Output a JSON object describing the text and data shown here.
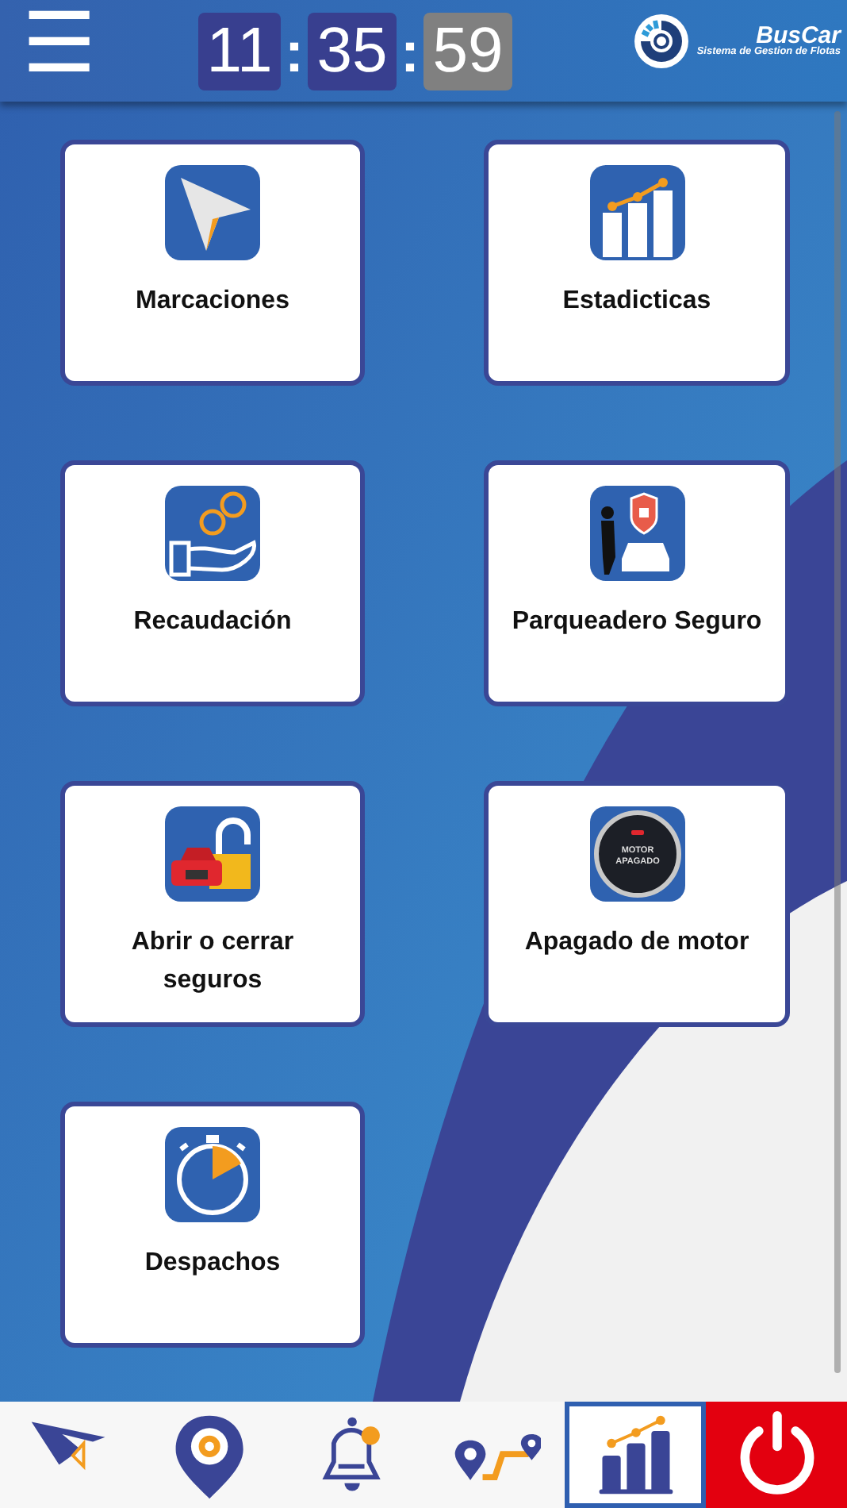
{
  "header": {
    "menu_label": "☰",
    "clock": [
      {
        "text": "11",
        "color": "#383f8f"
      },
      {
        "text": "35",
        "color": "#383f8f"
      },
      {
        "text": "59",
        "color": "#808080"
      }
    ],
    "separator": ":",
    "logo": {
      "title": "BusCar",
      "subtitle": "Sistema de Gestion de Flotas"
    }
  },
  "tiles": [
    {
      "label": "Marcaciones"
    },
    {
      "label": "Estadicticas"
    },
    {
      "label": "Recaudación"
    },
    {
      "label": "Parqueadero Seguro"
    },
    {
      "label": "Abrir o cerrar seguros"
    },
    {
      "label": "Apagado de motor"
    },
    {
      "label": "Despachos"
    }
  ],
  "engine_icon_text": [
    "MOTOR",
    "APAGADO"
  ],
  "bottom_nav": [
    {
      "kind": "plane",
      "selected": false
    },
    {
      "kind": "pin",
      "selected": false
    },
    {
      "kind": "bell",
      "selected": false
    },
    {
      "kind": "route",
      "selected": false
    },
    {
      "kind": "chart",
      "selected": true
    },
    {
      "kind": "power",
      "selected": false
    }
  ]
}
